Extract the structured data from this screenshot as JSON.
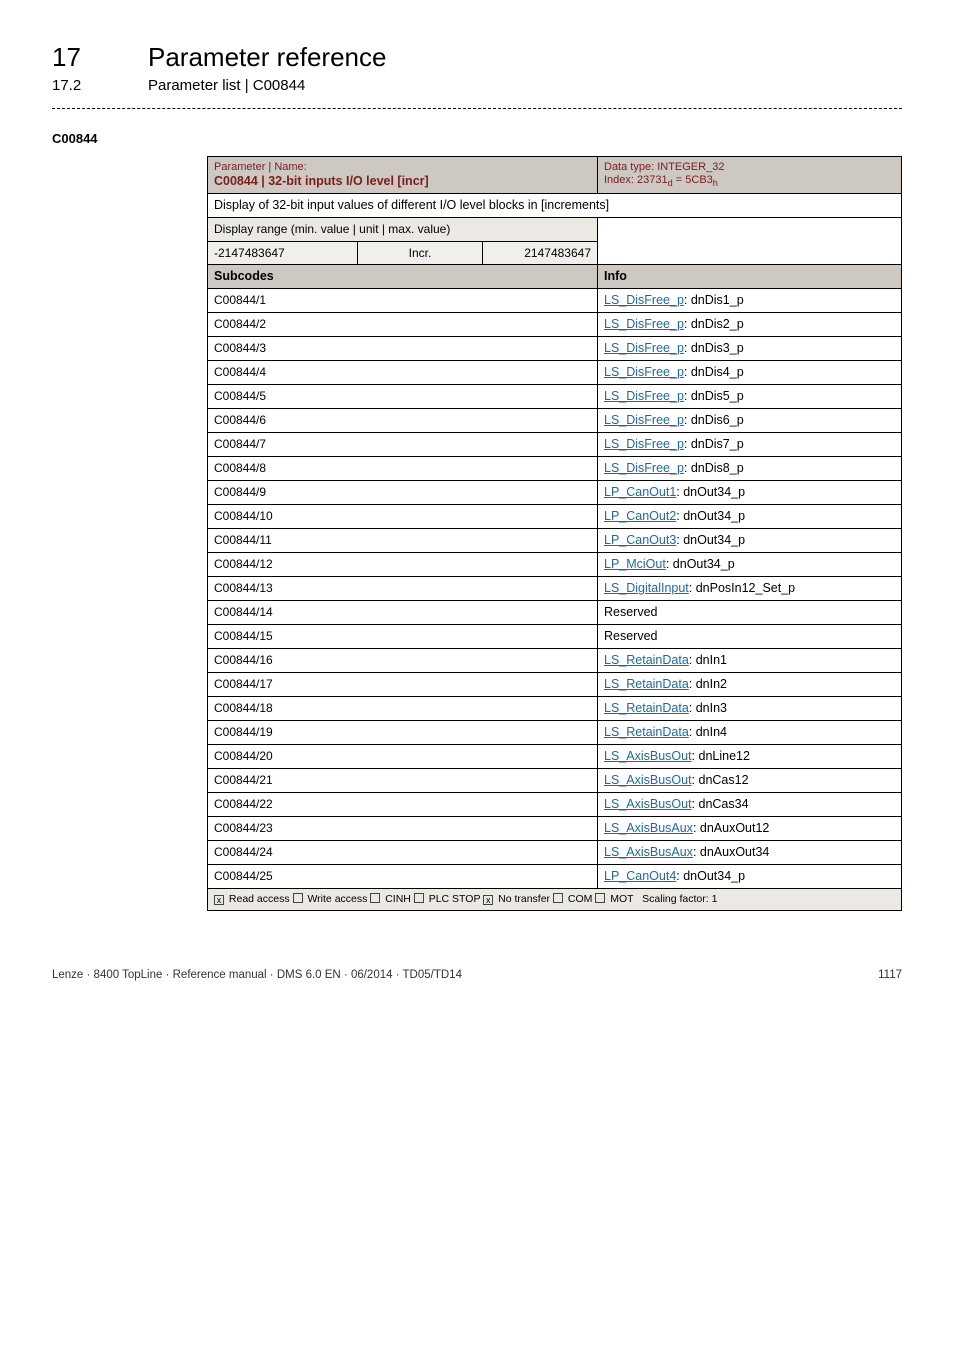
{
  "chapter": {
    "num": "17",
    "title": "Parameter reference"
  },
  "subchapter": {
    "num": "17.2",
    "title": "Parameter list | C00844"
  },
  "param_label": "C00844",
  "header": {
    "small": "Parameter | Name:",
    "name": "C00844 | 32-bit inputs I/O level [incr]",
    "datatype": "Data type: INTEGER_32",
    "index": "Index: 23731",
    "index_d": "d",
    "index_eq": " = 5CB3",
    "index_h": "h"
  },
  "description": "Display of 32-bit input values of different I/O level blocks in [increments]",
  "range_label": "Display range (min. value | unit | max. value)",
  "range": {
    "min": "-2147483647",
    "unit": "Incr.",
    "max": "2147483647"
  },
  "subhdr": {
    "left": "Subcodes",
    "right": "Info"
  },
  "rows": [
    {
      "code": "C00844/1",
      "link": "LS_DisFree_p",
      "suffix": ": dnDis1_p"
    },
    {
      "code": "C00844/2",
      "link": "LS_DisFree_p",
      "suffix": ": dnDis2_p"
    },
    {
      "code": "C00844/3",
      "link": "LS_DisFree_p",
      "suffix": ": dnDis3_p"
    },
    {
      "code": "C00844/4",
      "link": "LS_DisFree_p",
      "suffix": ": dnDis4_p"
    },
    {
      "code": "C00844/5",
      "link": "LS_DisFree_p",
      "suffix": ": dnDis5_p"
    },
    {
      "code": "C00844/6",
      "link": "LS_DisFree_p",
      "suffix": ": dnDis6_p"
    },
    {
      "code": "C00844/7",
      "link": "LS_DisFree_p",
      "suffix": ": dnDis7_p"
    },
    {
      "code": "C00844/8",
      "link": "LS_DisFree_p",
      "suffix": ": dnDis8_p"
    },
    {
      "code": "C00844/9",
      "link": "LP_CanOut1",
      "suffix": ": dnOut34_p"
    },
    {
      "code": "C00844/10",
      "link": "LP_CanOut2",
      "suffix": ": dnOut34_p"
    },
    {
      "code": "C00844/11",
      "link": "LP_CanOut3",
      "suffix": ": dnOut34_p"
    },
    {
      "code": "C00844/12",
      "link": "LP_MciOut",
      "suffix": ": dnOut34_p"
    },
    {
      "code": "C00844/13",
      "link": "LS_DigitalInput",
      "suffix": ": dnPosIn12_Set_p"
    },
    {
      "code": "C00844/14",
      "plain": "Reserved"
    },
    {
      "code": "C00844/15",
      "plain": "Reserved"
    },
    {
      "code": "C00844/16",
      "link": "LS_RetainData",
      "suffix": ": dnIn1"
    },
    {
      "code": "C00844/17",
      "link": "LS_RetainData",
      "suffix": ": dnIn2"
    },
    {
      "code": "C00844/18",
      "link": "LS_RetainData",
      "suffix": ": dnIn3"
    },
    {
      "code": "C00844/19",
      "link": "LS_RetainData",
      "suffix": ": dnIn4"
    },
    {
      "code": "C00844/20",
      "link": "LS_AxisBusOut",
      "suffix": ": dnLine12"
    },
    {
      "code": "C00844/21",
      "link": "LS_AxisBusOut",
      "suffix": ": dnCas12"
    },
    {
      "code": "C00844/22",
      "link": "LS_AxisBusOut",
      "suffix": ": dnCas34"
    },
    {
      "code": "C00844/23",
      "link": "LS_AxisBusAux",
      "suffix": ": dnAuxOut12"
    },
    {
      "code": "C00844/24",
      "link": "LS_AxisBusAux",
      "suffix": ": dnAuxOut34"
    },
    {
      "code": "C00844/25",
      "link": "LP_CanOut4",
      "suffix": ": dnOut34_p"
    }
  ],
  "footer_access": {
    "items": [
      {
        "checked": true,
        "label": "Read access"
      },
      {
        "checked": false,
        "label": "Write access"
      },
      {
        "checked": false,
        "label": "CINH"
      },
      {
        "checked": false,
        "label": "PLC STOP"
      },
      {
        "checked": true,
        "label": "No transfer"
      },
      {
        "checked": false,
        "label": "COM"
      },
      {
        "checked": false,
        "label": "MOT"
      }
    ],
    "scaling": "Scaling factor: 1"
  },
  "page_footer": {
    "left": "Lenze · 8400 TopLine · Reference manual · DMS 6.0 EN · 06/2014 · TD05/TD14",
    "right": "1117"
  }
}
